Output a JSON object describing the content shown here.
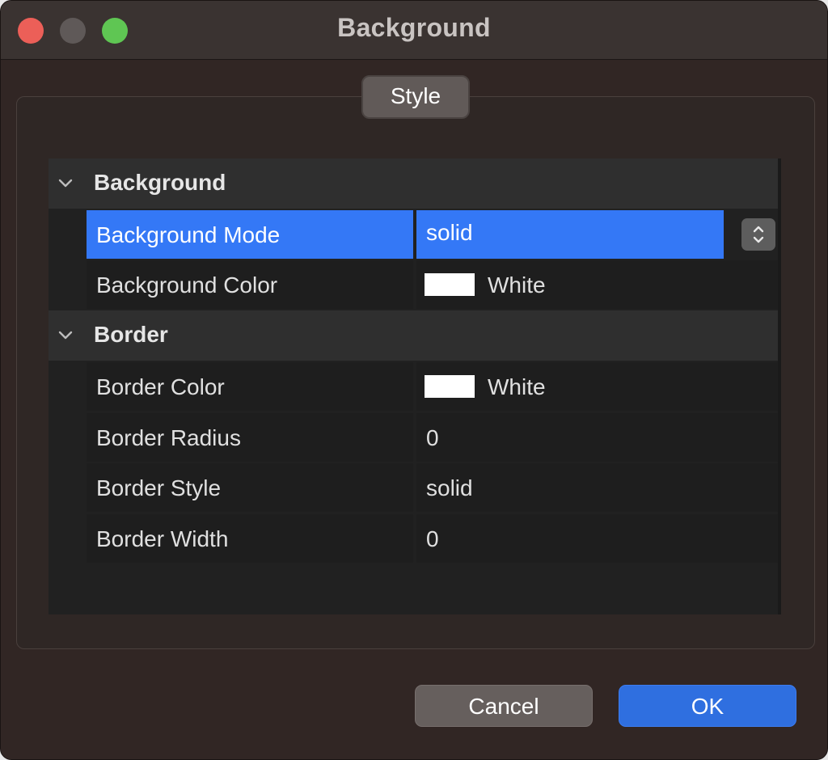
{
  "window": {
    "title": "Background"
  },
  "tabs": {
    "active_label": "Style"
  },
  "groups": [
    {
      "label": "Background",
      "properties": [
        {
          "name": "Background Mode",
          "value": "solid"
        },
        {
          "name": "Background Color",
          "value": "White",
          "swatch": "#ffffff"
        }
      ]
    },
    {
      "label": "Border",
      "properties": [
        {
          "name": "Border Color",
          "value": "White",
          "swatch": "#ffffff"
        },
        {
          "name": "Border Radius",
          "value": "0"
        },
        {
          "name": "Border Style",
          "value": "solid"
        },
        {
          "name": "Border Width",
          "value": "0"
        }
      ]
    }
  ],
  "buttons": {
    "cancel_label": "Cancel",
    "ok_label": "OK"
  },
  "colors": {
    "selection": "#3478f6",
    "ok_button": "#2f6fe0",
    "close": "#ec5f58",
    "maximize": "#5fc653"
  },
  "icons": {
    "expand": "chevron-down-icon",
    "spinner": "up-down-arrows-icon"
  }
}
